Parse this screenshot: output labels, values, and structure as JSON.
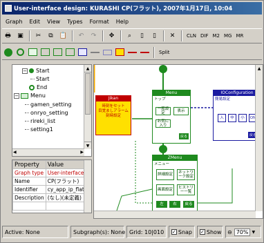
{
  "window": {
    "title": "User-interface design: KURASHI CP(フラット), 2007年1月17日, 10:04"
  },
  "menu": [
    "Graph",
    "Edit",
    "View",
    "Types",
    "Format",
    "Help"
  ],
  "toolbar1": {
    "cln": "CLN",
    "dif": "DIF",
    "m2": "M2",
    "mg": "MG",
    "mr": "MR"
  },
  "toolbar2": {
    "split": "Split"
  },
  "tree": {
    "items": [
      {
        "label": "Start"
      },
      {
        "label": "Start"
      },
      {
        "label": "End"
      },
      {
        "label": "Menu"
      },
      {
        "label": "gamen_setting"
      },
      {
        "label": "onryo_setting"
      },
      {
        "label": "rireki_list"
      },
      {
        "label": "setting1"
      }
    ]
  },
  "properties": {
    "header": [
      "Property",
      "Value"
    ],
    "rows": [
      {
        "key": "Graph type",
        "value": "User-interface"
      },
      {
        "key": "Name",
        "value": "CP(フラット)"
      },
      {
        "key": "Identifier",
        "value": "cy_app_ip_flat"
      },
      {
        "key": "Description",
        "value": "(なし)(未定義)"
      }
    ]
  },
  "canvas": {
    "jikan": {
      "head": "Jikan",
      "body": "時刻をセット\n目覚ましアラーム\n刻時設定"
    },
    "menu": {
      "head": "Menu",
      "sub": "トップ",
      "b1": "一般設定",
      "b2": "表示",
      "b3": "お気に入り",
      "foot": "戻る"
    },
    "config": {
      "head": "IOConfiguration",
      "sub": "簡易設定",
      "b1": "入",
      "b2": "中",
      "b3": "小",
      "b4": "ON",
      "foot": "戻る"
    },
    "zmenu": {
      "head": "ZMenu",
      "sub": "メニュー",
      "b1": "詳細設定",
      "b2": "ネットワーク設定",
      "b3": "画面設定",
      "b4": "ヒストリー一覧",
      "f1": "左",
      "f2": "右",
      "f3": "戻る"
    }
  },
  "status": {
    "active": "Active: None",
    "subgraphs": "Subgraph(s): None",
    "grid": "Grid: 10|010",
    "snap": "Snap",
    "show": "Show",
    "zoom": "70%"
  },
  "colors": {
    "title": "#0a246a",
    "green": "#1e8a1e",
    "red": "#c00000",
    "blue": "#1a1aa0",
    "yellow": "#ffe000"
  }
}
